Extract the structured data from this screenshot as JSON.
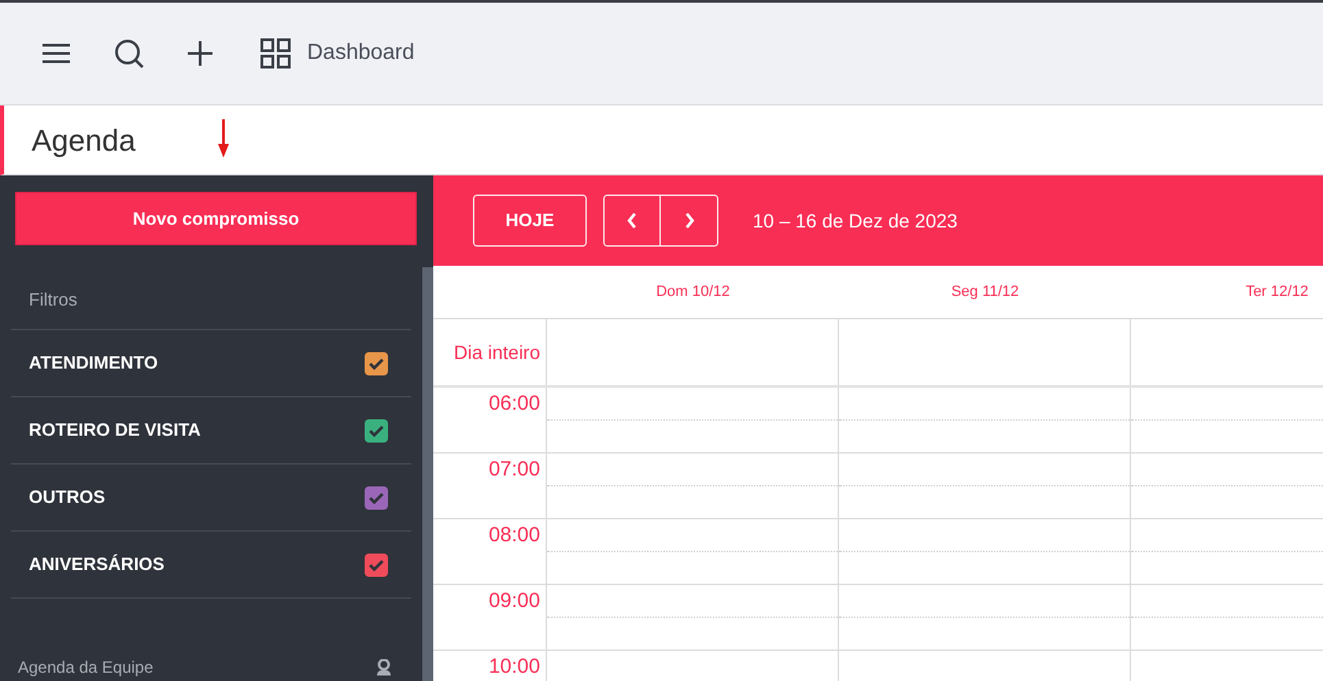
{
  "topbar": {
    "dashboard_label": "Dashboard"
  },
  "page_title": "Agenda",
  "sidebar": {
    "new_button": "Novo compromisso",
    "filters_title": "Filtros",
    "filters": [
      {
        "label": "ATENDIMENTO",
        "checked": true,
        "color": "#e8964a"
      },
      {
        "label": "ROTEIRO DE VISITA",
        "checked": true,
        "color": "#3bb07f"
      },
      {
        "label": "OUTROS",
        "checked": true,
        "color": "#9a67b8"
      },
      {
        "label": "ANIVERSÁRIOS",
        "checked": true,
        "color": "#ef4b5a"
      }
    ],
    "team_label": "Agenda da Equipe"
  },
  "calendar": {
    "today_button": "HOJE",
    "range": "10 – 16 de Dez de 2023",
    "days": [
      "Dom 10/12",
      "Seg 11/12",
      "Ter 12/12"
    ],
    "all_day_label": "Dia inteiro",
    "hours": [
      "06:00",
      "07:00",
      "08:00",
      "09:00",
      "10:00"
    ]
  }
}
